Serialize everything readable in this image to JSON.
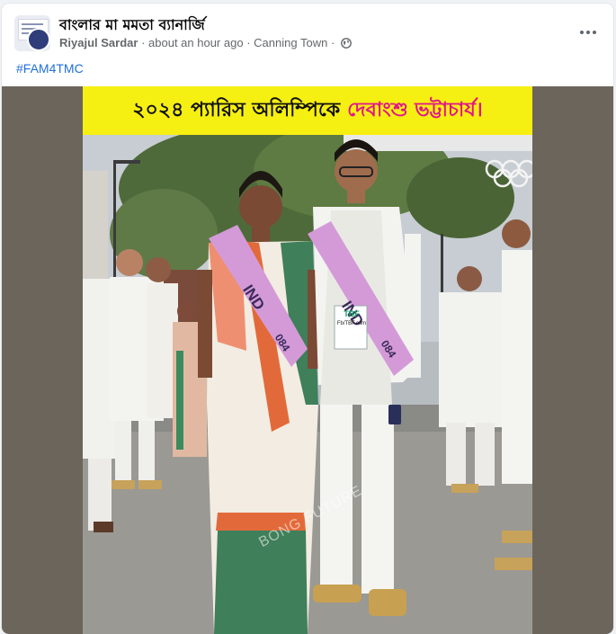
{
  "post": {
    "group_name": "বাংলার মা মমতা ব্যানার্জি",
    "author": "Riyajul Sardar",
    "time": "about an hour ago",
    "separator": "·",
    "location": "Canning Town",
    "privacy_icon": "globe-icon",
    "hashtag": "#FAM4TMC"
  },
  "image": {
    "banner_part1": "২০২৪ প্যারিস অলিম্পিকে",
    "banner_part2": "দেবাংশু ভট্টাচার্য।",
    "sash_text": "IND",
    "sash_num": "084",
    "badge_brand": "TBF",
    "badge_handle": "Fb/TBF.com",
    "watermark": "BONG FUTURE"
  },
  "colors": {
    "banner_bg": "#f6ef12",
    "banner_highlight": "#e0158a",
    "link": "#216fdb",
    "sash": "#d49ad8"
  }
}
